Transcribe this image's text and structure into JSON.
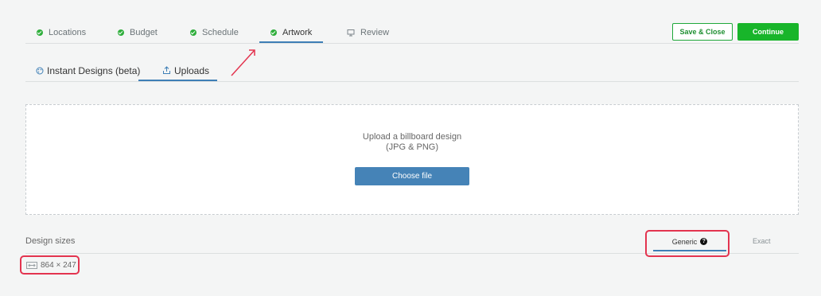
{
  "steps": [
    {
      "label": "Locations",
      "icon": "check-icon"
    },
    {
      "label": "Budget",
      "icon": "check-icon"
    },
    {
      "label": "Schedule",
      "icon": "check-icon"
    },
    {
      "label": "Artwork",
      "icon": "check-icon",
      "active": true
    },
    {
      "label": "Review",
      "icon": "monitor-icon"
    }
  ],
  "actions": {
    "save_close": "Save & Close",
    "continue": "Continue"
  },
  "subtabs": [
    {
      "label": "Instant Designs (beta)",
      "icon": "palette-icon"
    },
    {
      "label": "Uploads",
      "icon": "upload-icon",
      "active": true
    }
  ],
  "upload": {
    "title": "Upload a billboard design",
    "subtitle": "(JPG & PNG)",
    "button": "Choose file"
  },
  "design_sizes": {
    "title": "Design sizes",
    "toggle": [
      {
        "label": "Generic",
        "icon": "help-icon",
        "active": true
      },
      {
        "label": "Exact"
      }
    ],
    "sizes": [
      "864 × 247"
    ]
  },
  "colors": {
    "accent": "#3e7fb6",
    "success": "#18b52a",
    "annotation": "#e3344f"
  }
}
